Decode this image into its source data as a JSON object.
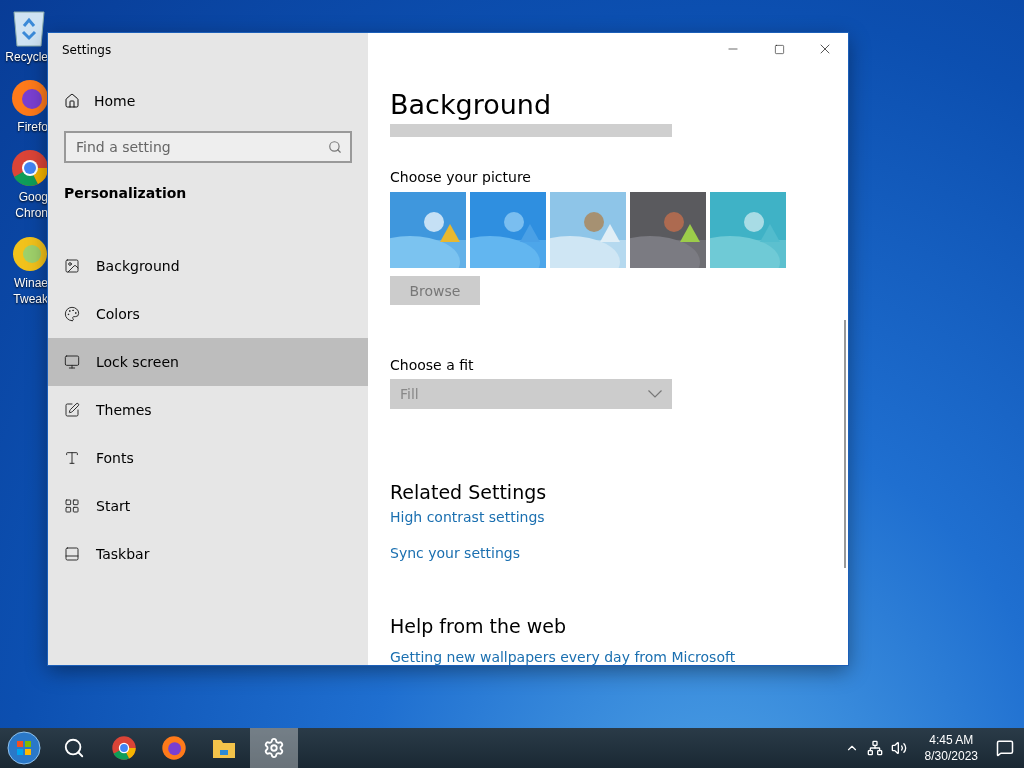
{
  "desktop_icons": [
    {
      "kind": "recycle",
      "lines": [
        "Recycle"
      ]
    },
    {
      "kind": "firefox",
      "lines": [
        "Firefo"
      ]
    },
    {
      "kind": "chrome",
      "lines": [
        "Goog",
        "Chron"
      ]
    },
    {
      "kind": "tweaker",
      "lines": [
        "Winae",
        "Tweak"
      ]
    }
  ],
  "window": {
    "title": "Settings"
  },
  "sidebar": {
    "home": "Home",
    "search": {
      "placeholder": "Find a setting"
    },
    "section": "Personalization",
    "items": [
      {
        "kind": "background",
        "label": "Background",
        "selected": false
      },
      {
        "kind": "colors",
        "label": "Colors",
        "selected": false
      },
      {
        "kind": "lock",
        "label": "Lock screen",
        "selected": true
      },
      {
        "kind": "themes",
        "label": "Themes",
        "selected": false
      },
      {
        "kind": "fonts",
        "label": "Fonts",
        "selected": false
      },
      {
        "kind": "start",
        "label": "Start",
        "selected": false
      },
      {
        "kind": "taskbar",
        "label": "Taskbar",
        "selected": false
      }
    ]
  },
  "content": {
    "title": "Background",
    "picture_label": "Choose your picture",
    "pictures": [
      {
        "kind": "picture"
      },
      {
        "kind": "picture"
      },
      {
        "kind": "picture"
      },
      {
        "kind": "picture"
      },
      {
        "kind": "picture"
      }
    ],
    "browse": {
      "label": "Browse",
      "disabled": true
    },
    "fit_label": "Choose a fit",
    "fit": {
      "value": "Fill",
      "disabled": true
    },
    "related_title": "Related Settings",
    "related_links": [
      "High contrast settings",
      "Sync your settings"
    ],
    "help_title": "Help from the web",
    "help_links": [
      "Getting new wallpapers every day from Microsoft"
    ]
  },
  "taskbar": {
    "apps": [
      {
        "kind": "start",
        "selected": false
      },
      {
        "kind": "search",
        "selected": false
      },
      {
        "kind": "chrome",
        "selected": false
      },
      {
        "kind": "firefox",
        "selected": false
      },
      {
        "kind": "explorer",
        "selected": false
      },
      {
        "kind": "settings",
        "selected": true
      }
    ],
    "time": "4:45 AM",
    "date": "8/30/2023"
  }
}
